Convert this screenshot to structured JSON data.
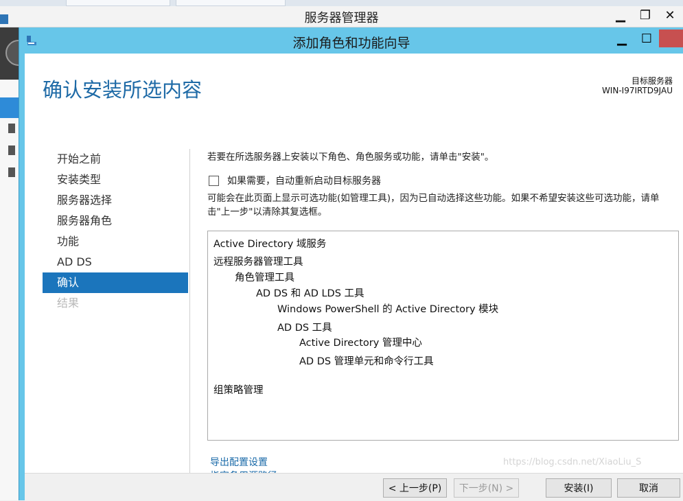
{
  "outer_window": {
    "title": "服务器管理器",
    "minimize": "▁",
    "maximize": "❐",
    "close": "✕"
  },
  "wizard": {
    "title": "添加角色和功能向导",
    "minimize": "▁",
    "maximize": "☐",
    "page_title": "确认安装所选内容",
    "target_label": "目标服务器",
    "target_name": "WIN-I97IRTD9JAU",
    "nav": [
      {
        "label": "开始之前",
        "state": "normal"
      },
      {
        "label": "安装类型",
        "state": "normal"
      },
      {
        "label": "服务器选择",
        "state": "normal"
      },
      {
        "label": "服务器角色",
        "state": "normal"
      },
      {
        "label": "功能",
        "state": "normal"
      },
      {
        "label": "AD DS",
        "state": "normal"
      },
      {
        "label": "确认",
        "state": "active"
      },
      {
        "label": "结果",
        "state": "disabled"
      }
    ],
    "intro": "若要在所选服务器上安装以下角色、角色服务或功能，请单击\"安装\"。",
    "restart_checkbox": {
      "label": "如果需要，自动重新启动目标服务器",
      "checked": false
    },
    "note": "可能会在此页面上显示可选功能(如管理工具)，因为已自动选择这些功能。如果不希望安装这些可选功能，请单击\"上一步\"以清除其复选框。",
    "features": [
      "Active Directory 域服务",
      "远程服务器管理工具",
      "角色管理工具",
      "AD DS 和 AD LDS 工具",
      "Windows PowerShell 的 Active Directory 模块",
      "AD DS 工具",
      "Active Directory 管理中心",
      "AD DS 管理单元和命令行工具",
      "组策略管理"
    ],
    "links": {
      "export": "导出配置设置",
      "alternate_source": "指定备用源路径"
    },
    "buttons": {
      "previous": "< 上一步(P)",
      "next": "下一步(N) >",
      "install": "安装(I)",
      "cancel": "取消"
    }
  },
  "watermark": "https://blog.csdn.net/XiaoLiu_S",
  "colors": {
    "title_bar": "#67c6e9",
    "accent": "#1b75bc",
    "page_title": "#1e6aa6",
    "link": "#1a6aa8"
  }
}
